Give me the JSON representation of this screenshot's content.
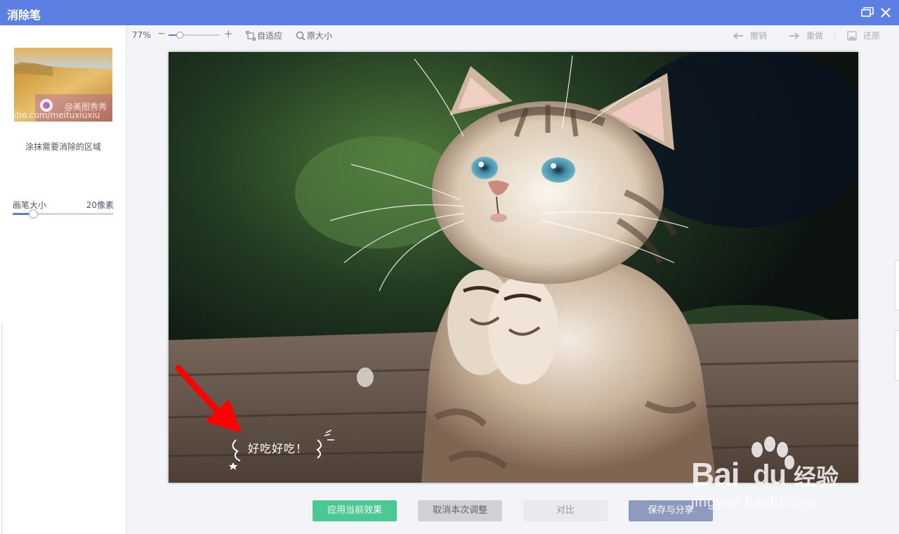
{
  "window": {
    "title": "消除笔"
  },
  "left_panel": {
    "thumbnail_watermark": "@美图秀秀",
    "thumbnail_url": "ibo.com/meituxiuxiu",
    "hint": "涂抹需要消除的区域",
    "brush_label": "画笔大小",
    "brush_value": "20像素",
    "brush_fraction": 0.2
  },
  "toolbar": {
    "zoom": "77%",
    "zoom_fraction": 0.22,
    "fit_label": "自适应",
    "original_label": "原大小",
    "undo_label": "撤销",
    "redo_label": "重做",
    "restore_label": "还原"
  },
  "canvas": {
    "caption": "好吃好吃！"
  },
  "buttons": {
    "apply": "应用当前效果",
    "cancel": "取消本次调整",
    "compare": "对比",
    "save": "保存与分享"
  },
  "watermark": {
    "brand": "Bai",
    "brand_du": "du",
    "brand_cn": "经验",
    "url": "jingyan.baidu.com"
  },
  "colors": {
    "titlebar": "#5b7fe3",
    "apply_button": "#4cc894",
    "save_button": "#8e9bbf",
    "arrow": "#ff0000"
  }
}
